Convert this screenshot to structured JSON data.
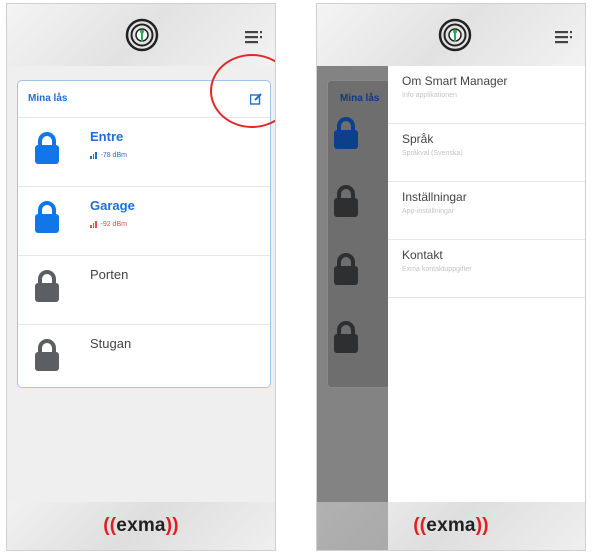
{
  "screen1": {
    "card_title": "Mina lås",
    "locks": [
      {
        "name": "Entre",
        "signal": "-78 dBm",
        "signal_color": "#1f6fd0",
        "lock_color": "#1276e8",
        "active": true
      },
      {
        "name": "Garage",
        "signal": "-92 dBm",
        "signal_color": "#e05050",
        "lock_color": "#1276e8",
        "active": true
      },
      {
        "name": "Porten",
        "signal": "",
        "lock_color": "#5b5f63",
        "active": false
      },
      {
        "name": "Stugan",
        "signal": "",
        "lock_color": "#5b5f63",
        "active": false
      }
    ],
    "brand": {
      "prefix": "((",
      "mid1": "exma",
      "mid2": "))"
    }
  },
  "screen2": {
    "card_title": "Mina lås",
    "menu": [
      {
        "title": "Om Smart Manager",
        "subtitle": "Info applikationen"
      },
      {
        "title": "Språk",
        "subtitle": "Språkval (Svenska)"
      },
      {
        "title": "Inställningar",
        "subtitle": "App-inställningar"
      },
      {
        "title": "Kontakt",
        "subtitle": "Exma kontaktuppgifter"
      }
    ],
    "brand": {
      "prefix": "((",
      "mid1": "exma",
      "mid2": "))"
    }
  },
  "colors": {
    "accent": "#1f6fd0",
    "highlight_circle": "#e0282b",
    "brand_red": "#e02020"
  }
}
